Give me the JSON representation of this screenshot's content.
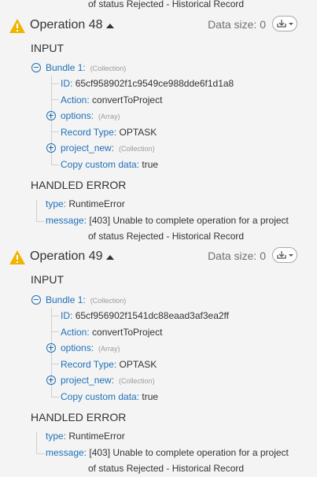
{
  "top_continuation": "of status Rejected - Historical Record",
  "operations": [
    {
      "title": "Operation 48",
      "data_size": "Data size: 0",
      "input_label": "INPUT",
      "bundle_label": "Bundle 1:",
      "bundle_hint": "(Collection)",
      "id_key": "ID:",
      "id_val": "65cf958902f1c9549ce988dde6f1d1a8",
      "action_key": "Action:",
      "action_val": "convertToProject",
      "options_key": "options:",
      "options_hint": "(Array)",
      "record_key": "Record Type:",
      "record_val": "OPTASK",
      "project_key": "project_new:",
      "project_hint": "(Collection)",
      "copy_key": "Copy custom data:",
      "copy_val": "true",
      "error_label": "HANDLED ERROR",
      "type_key": "type:",
      "type_val": "RuntimeError",
      "message_key": "message:",
      "message_line1": "[403] Unable to complete operation for a project",
      "message_line2": "of status Rejected - Historical Record"
    },
    {
      "title": "Operation 49",
      "data_size": "Data size: 0",
      "input_label": "INPUT",
      "bundle_label": "Bundle 1:",
      "bundle_hint": "(Collection)",
      "id_key": "ID:",
      "id_val": "65cf956902f1541dc88eaad3af3ea2ff",
      "action_key": "Action:",
      "action_val": "convertToProject",
      "options_key": "options:",
      "options_hint": "(Array)",
      "record_key": "Record Type:",
      "record_val": "OPTASK",
      "project_key": "project_new:",
      "project_hint": "(Collection)",
      "copy_key": "Copy custom data:",
      "copy_val": "true",
      "error_label": "HANDLED ERROR",
      "type_key": "type:",
      "type_val": "RuntimeError",
      "message_key": "message:",
      "message_line1": "[403] Unable to complete operation for a project",
      "message_line2": "of status Rejected - Historical Record"
    }
  ],
  "icons": {
    "warning": "warning-triangle-icon",
    "download": "download-dropdown-icon",
    "collapse": "collapse-circle-icon",
    "expand": "expand-circle-icon"
  },
  "colors": {
    "warning": "#f0b400",
    "key_blue": "#1f70b8",
    "background": "#f4f4f4"
  }
}
